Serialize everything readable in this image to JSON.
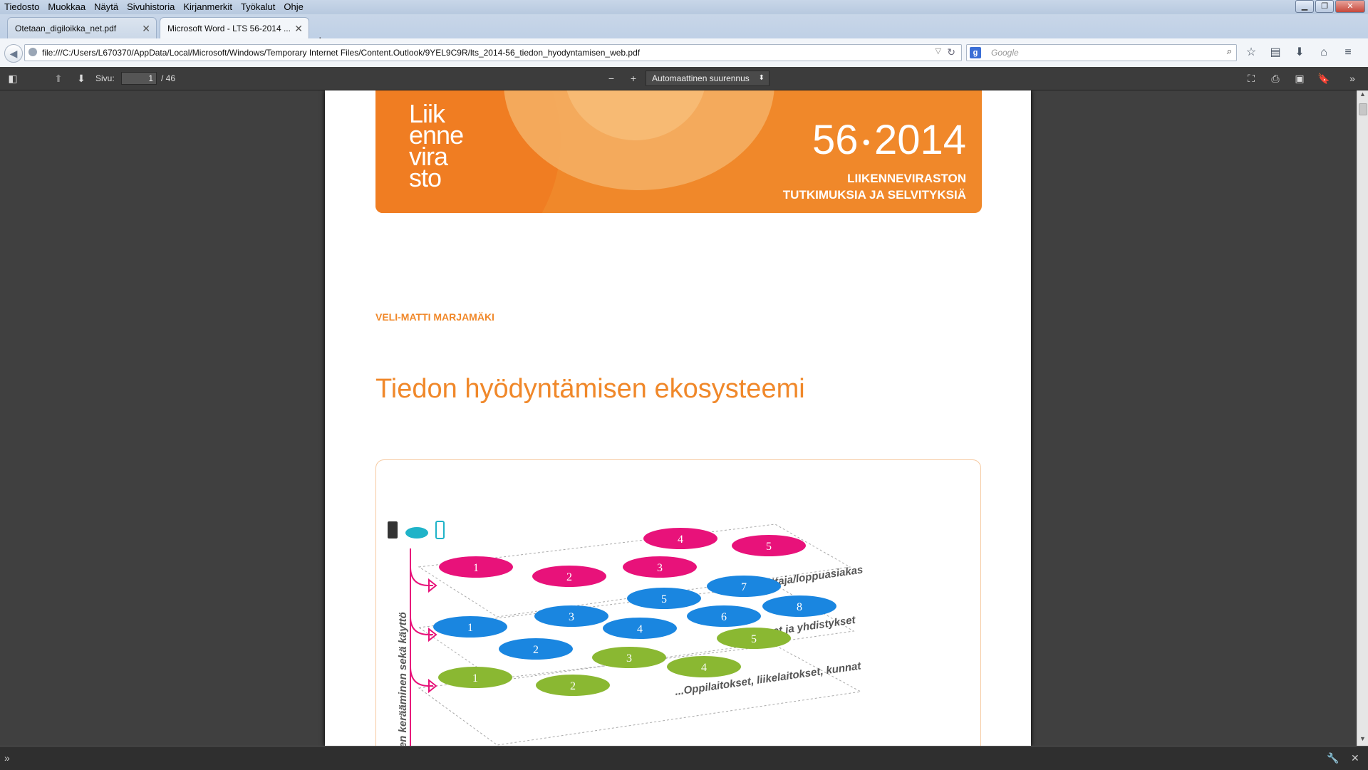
{
  "menubar": {
    "items": [
      "Tiedosto",
      "Muokkaa",
      "Näytä",
      "Sivuhistoria",
      "Kirjanmerkit",
      "Työkalut",
      "Ohje"
    ]
  },
  "tabs": [
    {
      "label": "Otetaan_digiloikka_net.pdf",
      "active": false
    },
    {
      "label": "Microsoft Word - LTS 56-2014 ...",
      "active": true
    }
  ],
  "address": {
    "url": "file:///C:/Users/L670370/AppData/Local/Microsoft/Windows/Temporary Internet Files/Content.Outlook/9YEL9C9R/lts_2014-56_tiedon_hyodyntamisen_web.pdf"
  },
  "search": {
    "placeholder": "Google",
    "engine_icon": "g-icon"
  },
  "pdf_toolbar": {
    "page_label": "Sivu:",
    "page_current": "1",
    "page_total": "/ 46",
    "zoom": "Automaattinen suurennus"
  },
  "document": {
    "logo_lines": [
      "Liik",
      "enne",
      "vira",
      "sto"
    ],
    "issue_number": "56",
    "issue_dot": "•",
    "issue_year": "2014",
    "series_line1": "LIIKENNEVIRASTON",
    "series_line2": "TUTKIMUKSIA JA SELVITYKSIÄ",
    "author": "VELI-MATTI MARJAMÄKI",
    "title": "Tiedon hyödyntämisen ekosysteemi"
  },
  "diagram": {
    "vertical_label": "...iden kerääminen sekä käyttö",
    "layer_labels": [
      "Kuluttaja/loppuasiakas",
      "Yritykset ja yhdistykset",
      "...Oppilaitokset, liikelaitokset, kunnat"
    ],
    "pink_nodes": [
      "1",
      "2",
      "3",
      "4",
      "5"
    ],
    "blue_nodes": [
      "1",
      "2",
      "3",
      "4",
      "5",
      "6",
      "7",
      "8"
    ],
    "green_nodes": [
      "1",
      "2",
      "3",
      "4",
      "5"
    ],
    "colors": {
      "pink": "#e8127a",
      "blue": "#1a86e0",
      "green": "#8ab832",
      "orange": "#f0882a"
    }
  }
}
